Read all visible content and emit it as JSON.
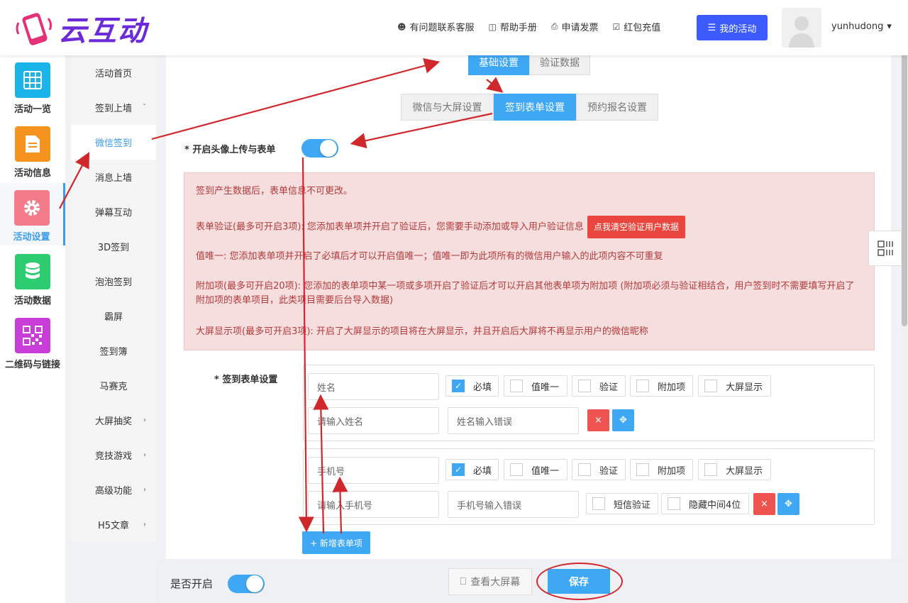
{
  "header": {
    "logo_text": "云互动",
    "links": [
      {
        "icon": "user-plus-icon",
        "label": "有问题联系客服"
      },
      {
        "icon": "book-icon",
        "label": "帮助手册"
      },
      {
        "icon": "printer-icon",
        "label": "申请发票"
      },
      {
        "icon": "shield-check-icon",
        "label": "红包充值"
      }
    ],
    "my_activity": "我的活动",
    "username": "yunhudong"
  },
  "sidebar": {
    "items": [
      {
        "label": "活动一览",
        "color": "#1ab4e8",
        "icon": "grid-icon"
      },
      {
        "label": "活动信息",
        "color": "#f5931e",
        "icon": "document-icon"
      },
      {
        "label": "活动设置",
        "color": "#f47c8a",
        "icon": "gear-icon",
        "active": true
      },
      {
        "label": "活动数据",
        "color": "#2ecc71",
        "icon": "database-icon"
      },
      {
        "label": "二维码与链接",
        "color": "#c83cd8",
        "icon": "qrcode-icon"
      }
    ]
  },
  "subnav": {
    "items": [
      {
        "label": "活动首页",
        "arrow": ""
      },
      {
        "label": "签到上墙",
        "arrow": "ˇ"
      },
      {
        "label": "微信签到",
        "arrow": "",
        "active": true
      },
      {
        "label": "消息上墙",
        "arrow": ""
      },
      {
        "label": "弹幕互动",
        "arrow": ""
      },
      {
        "label": "3D签到",
        "arrow": ""
      },
      {
        "label": "泡泡签到",
        "arrow": ""
      },
      {
        "label": "霸屏",
        "arrow": ""
      },
      {
        "label": "签到簿",
        "arrow": ""
      },
      {
        "label": "马赛克",
        "arrow": ""
      },
      {
        "label": "大屏抽奖",
        "arrow": "›"
      },
      {
        "label": "竞技游戏",
        "arrow": "›"
      },
      {
        "label": "高级功能",
        "arrow": "›"
      },
      {
        "label": "H5文章",
        "arrow": "›"
      }
    ]
  },
  "tabs_primary": [
    "基础设置",
    "验证数据"
  ],
  "tabs_secondary": [
    "微信与大屏设置",
    "签到表单设置",
    "预约报名设置"
  ],
  "avatar_upload": {
    "label": "* 开启头像上传与表单",
    "enabled": true
  },
  "notice": {
    "line1": "签到产生数据后，表单信息不可更改。",
    "line2": "表单验证(最多可开启3项): 您添加表单项并开启了验证后，您需要手动添加或导入用户验证信息",
    "clear_button": "点我清空验证用户数据",
    "line3": "值唯一: 您添加表单项并开启了必填后才可以开启值唯一；值唯一即为此项所有的微信用户输入的此项内容不可重复",
    "line4": "附加项(最多可开启20项): 您添加的表单项中某一项或多项开启了验证后才可以开启其他表单项为附加项 (附加项必须与验证相结合，用户签到时不需要填写开启了附加项的表单项目，此类项目需要后台导入数据)",
    "line5": "大屏显示项(最多可开启3项): 开启了大屏显示的项目将在大屏显示，并且开启后大屏将不再显示用户的微信昵称"
  },
  "form": {
    "label": "* 签到表单设置",
    "field1": {
      "name": "姓名",
      "placeholder": "请输入姓名",
      "error": "姓名输入错误",
      "options": [
        {
          "label": "必填",
          "checked": true
        },
        {
          "label": "值唯一",
          "checked": false
        },
        {
          "label": "验证",
          "checked": false
        },
        {
          "label": "附加项",
          "checked": false
        },
        {
          "label": "大屏显示",
          "checked": false
        }
      ]
    },
    "field2": {
      "name": "手机号",
      "placeholder": "请输入手机号",
      "error": "手机号输入错误",
      "options": [
        {
          "label": "必填",
          "checked": true
        },
        {
          "label": "值唯一",
          "checked": false
        },
        {
          "label": "验证",
          "checked": false
        },
        {
          "label": "附加项",
          "checked": false
        },
        {
          "label": "大屏显示",
          "checked": false
        }
      ],
      "sms": "短信验证",
      "hide_middle": "隐藏中间4位"
    },
    "add_button": "+ 新增表单项",
    "delete_glyph": "×",
    "move_glyph": "✥"
  },
  "footer": {
    "enable_label": "是否开启",
    "enabled": true,
    "view_screen": "查看大屏幕",
    "save": "保存"
  },
  "colors": {
    "primary": "#3ea8f5",
    "nav_blue": "#3b5bfd",
    "danger": "#e9473e",
    "annotation": "#d0272c"
  }
}
